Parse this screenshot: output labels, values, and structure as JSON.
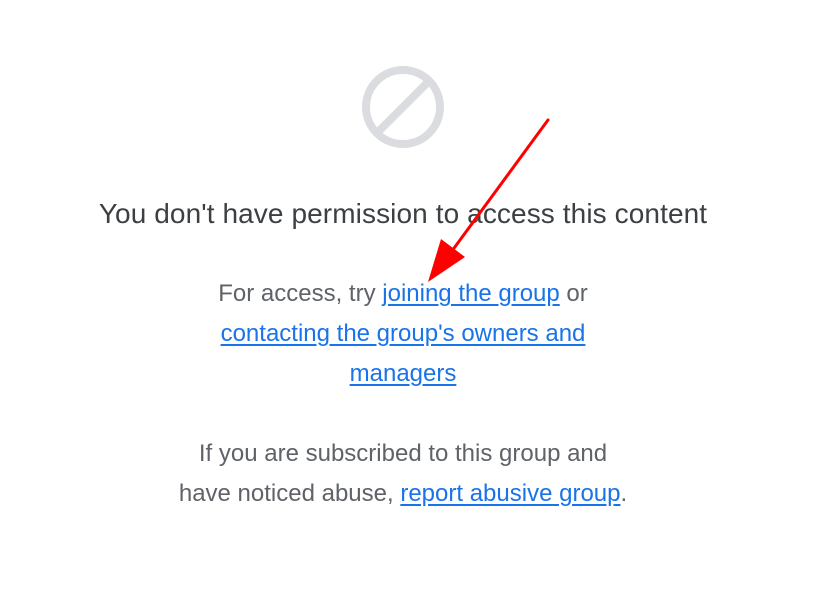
{
  "icons": {
    "blocked": "no-entry-icon"
  },
  "colors": {
    "icon_gray": "#dadce0",
    "title_text": "#3c4043",
    "body_text": "#5f6368",
    "link": "#1a73e8",
    "arrow": "#ff0000"
  },
  "title": "You don't have permission to access this content",
  "access": {
    "prefix": "For access, try ",
    "join_link": "joining the group",
    "or_text": " or",
    "contact_link_line1": "contacting the group's owners and",
    "contact_link_line2": "managers"
  },
  "abuse": {
    "line1": "If you are subscribed to this group and",
    "prefix": "have noticed abuse, ",
    "report_link": "report abusive group",
    "suffix": "."
  }
}
